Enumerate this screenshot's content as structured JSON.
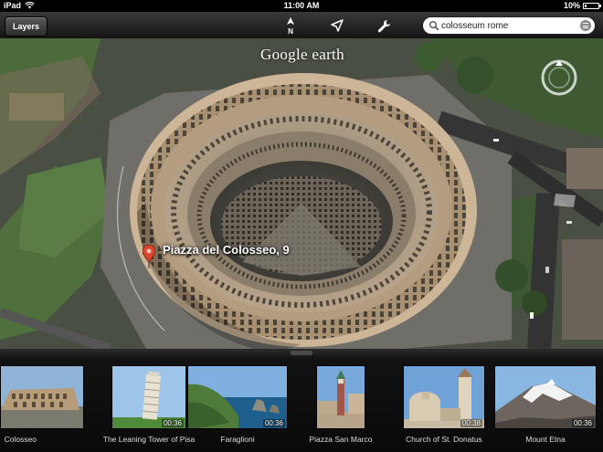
{
  "status_bar": {
    "device": "iPad",
    "time": "11:00 AM",
    "battery": "10%"
  },
  "toolbar": {
    "layers_label": "Layers",
    "north_label": "N",
    "search_value": "colosseum rome"
  },
  "map": {
    "brand": "Google earth",
    "place_label": "Piazza del Colosseo, 9"
  },
  "tours": [
    {
      "title": "Colosseo",
      "duration": ""
    },
    {
      "title": "The Leaning Tower of Pisa",
      "duration": "00:36"
    },
    {
      "title": "Faraglioni",
      "duration": "00:36"
    },
    {
      "title": "Piazza San Marco",
      "duration": ""
    },
    {
      "title": "Church of St. Donatus",
      "duration": "00:38"
    },
    {
      "title": "Mount Etna",
      "duration": "00:36"
    }
  ],
  "colors": {
    "toolbar": "#1e1e1e",
    "pin": "#d8452e",
    "accent": "#ffffff"
  }
}
